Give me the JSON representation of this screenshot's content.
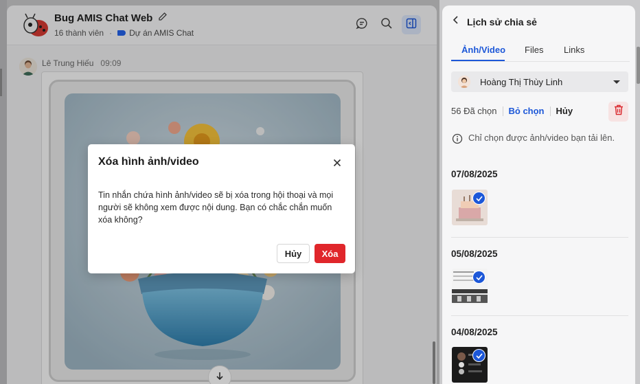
{
  "chat": {
    "title": "Bug AMIS Chat Web",
    "members": "16 thành viên",
    "separator": "·",
    "project": "Dự án AMIS Chat",
    "message": {
      "sender": "Lê Trung Hiếu",
      "time": "09:09"
    }
  },
  "share_panel": {
    "title": "Lịch sử chia sẻ",
    "tabs": [
      {
        "label": "Ảnh/Video",
        "active": true
      },
      {
        "label": "Files",
        "active": false
      },
      {
        "label": "Links",
        "active": false
      }
    ],
    "user_filter": "Hoàng Thị Thùy Linh",
    "selected_count": "56 Đã chọn",
    "deselect_label": "Bỏ chọn",
    "cancel_label": "Hủy",
    "info": "Chỉ chọn được ảnh/video bạn tải lên.",
    "groups": [
      {
        "date": "07/08/2025",
        "selected": true
      },
      {
        "date": "05/08/2025",
        "selected": true
      },
      {
        "date": "04/08/2025",
        "selected": true
      }
    ]
  },
  "modal": {
    "title": "Xóa hình ảnh/video",
    "body": "Tin nhắn chứa hình ảnh/video sẽ bị xóa trong hội thoại và mọi người sẽ không xem được nội dung. Bạn có chắc chắn muốn xóa không?",
    "cancel_label": "Hủy",
    "confirm_label": "Xóa"
  },
  "colors": {
    "accent": "#1c57d8",
    "danger": "#e0262b",
    "overlay": "rgba(0,0,0,0.22)"
  },
  "icons": [
    "edit-icon",
    "tag-icon",
    "chat-thread-icon",
    "search-icon",
    "sidebar-toggle-icon",
    "arrow-down-icon",
    "back-arrow-icon",
    "trash-icon",
    "info-icon",
    "check-icon",
    "close-icon"
  ]
}
